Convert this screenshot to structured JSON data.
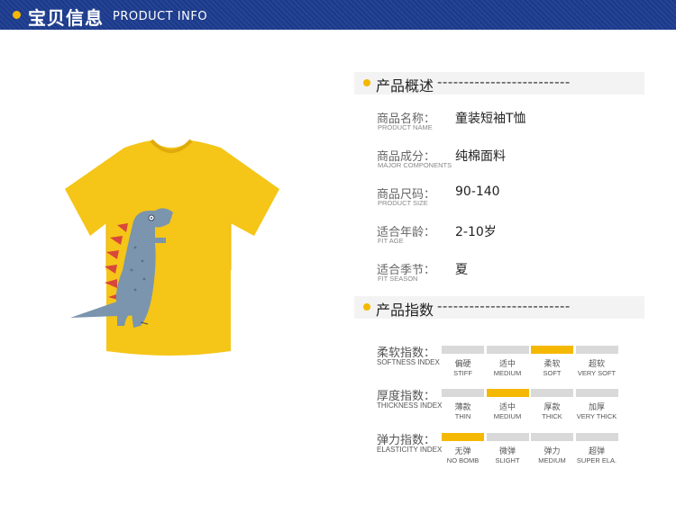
{
  "header": {
    "title_cn": "宝贝信息",
    "title_en": "PRODUCT INFO"
  },
  "colors": {
    "header_bg": "#1b3a8c",
    "accent": "#f5b800",
    "shirt": "#f5c518",
    "dino": "#7a95ad"
  },
  "overview": {
    "title": "产品概述",
    "dashes": "-------------------------",
    "rows": [
      {
        "label_cn": "商品名称：",
        "label_en": "PRODUCT NAME",
        "value": "童装短袖T恤"
      },
      {
        "label_cn": "商品成分：",
        "label_en": "MAJOR COMPONENTS",
        "value": "纯棉面料"
      },
      {
        "label_cn": "商品尺码：",
        "label_en": "PRODUCT SIZE",
        "value": "90-140"
      },
      {
        "label_cn": "适合年龄：",
        "label_en": "FIT AGE",
        "value": "2-10岁"
      },
      {
        "label_cn": "适合季节：",
        "label_en": "FIT SEASON",
        "value": "夏"
      }
    ]
  },
  "index": {
    "title": "产品指数",
    "dashes": "-------------------------",
    "rows": [
      {
        "label_cn": "柔软指数：",
        "label_en": "SOFTNESS INDEX",
        "selected": 2,
        "options": [
          {
            "cn": "偏硬",
            "en": "STIFF"
          },
          {
            "cn": "适中",
            "en": "MEDIUM"
          },
          {
            "cn": "柔软",
            "en": "SOFT"
          },
          {
            "cn": "超软",
            "en": "VERY SOFT"
          }
        ]
      },
      {
        "label_cn": "厚度指数：",
        "label_en": "THICKNESS INDEX",
        "selected": 1,
        "options": [
          {
            "cn": "薄款",
            "en": "THIN"
          },
          {
            "cn": "适中",
            "en": "MEDIUM"
          },
          {
            "cn": "厚款",
            "en": "THICK"
          },
          {
            "cn": "加厚",
            "en": "VERY THICK"
          }
        ]
      },
      {
        "label_cn": "弹力指数：",
        "label_en": "ELASTICITY INDEX",
        "selected": 0,
        "options": [
          {
            "cn": "无弹",
            "en": "NO BOMB"
          },
          {
            "cn": "微弹",
            "en": "SLIGHT"
          },
          {
            "cn": "弹力",
            "en": "MEDIUM"
          },
          {
            "cn": "超弹",
            "en": "SUPER ELA."
          }
        ]
      }
    ]
  }
}
